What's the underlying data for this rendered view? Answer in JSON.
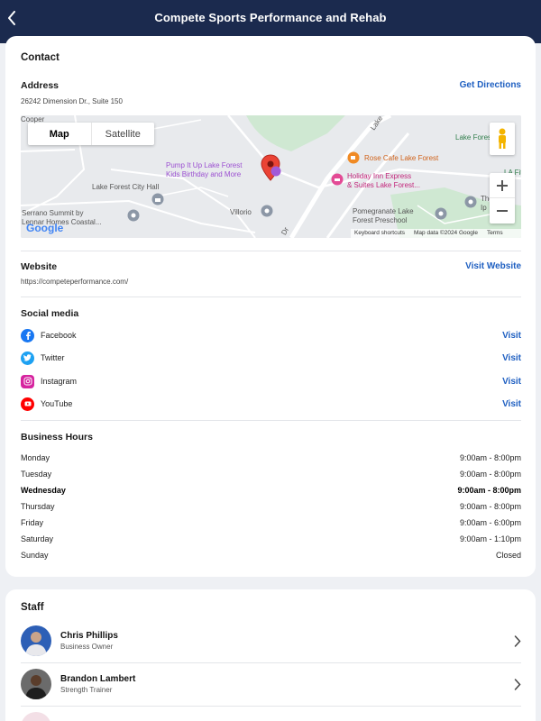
{
  "header": {
    "title": "Compete Sports Performance and Rehab",
    "back_icon": "chevron-left-icon"
  },
  "contact": {
    "title": "Contact",
    "address_label": "Address",
    "address_value": "26242 Dimension Dr., Suite 150",
    "directions_link": "Get Directions",
    "map": {
      "type_map": "Map",
      "type_satellite": "Satellite",
      "places": {
        "pump": "Pump It Up Lake Forest",
        "pump2": "Kids Birthday and More",
        "rose": "Rose Cafe Lake Forest",
        "holiday1": "Holiday Inn Express",
        "holiday2": "& Suites Lake Forest...",
        "cityhall": "Lake Forest City Hall",
        "serrano1": "Serrano Summit by",
        "serrano2": "Lennar Homes Coastal...",
        "villorio": "Villorio",
        "pome1": "Pomegranate Lake",
        "pome2": "Forest Preschool",
        "lakeforest": "Lake Forest",
        "cooper": "Cooper",
        "the": "The",
        "ip": "Ip",
        "lafit": "LA Fitn",
        "lake_road": "Lake",
        "dr_road": "Dr"
      },
      "google": "Google",
      "shortcuts": "Keyboard shortcuts",
      "mapdata": "Map data ©2024 Google",
      "terms": "Terms"
    },
    "website_label": "Website",
    "website_value": "https://competeperformance.com/",
    "website_link": "Visit Website",
    "social_title": "Social media",
    "social": [
      {
        "name": "Facebook",
        "action": "Visit",
        "color": "#1877f2"
      },
      {
        "name": "Twitter",
        "action": "Visit",
        "color": "#1da1f2"
      },
      {
        "name": "Instagram",
        "action": "Visit",
        "color": "#d6249f"
      },
      {
        "name": "YouTube",
        "action": "Visit",
        "color": "#ff0000"
      }
    ],
    "hours_title": "Business Hours",
    "hours": [
      {
        "day": "Monday",
        "time": "9:00am - 8:00pm"
      },
      {
        "day": "Tuesday",
        "time": "9:00am - 8:00pm"
      },
      {
        "day": "Wednesday",
        "time": "9:00am - 8:00pm",
        "today": true
      },
      {
        "day": "Thursday",
        "time": "9:00am - 8:00pm"
      },
      {
        "day": "Friday",
        "time": "9:00am - 6:00pm"
      },
      {
        "day": "Saturday",
        "time": "9:00am - 1:10pm"
      },
      {
        "day": "Sunday",
        "time": "Closed"
      }
    ]
  },
  "staff": {
    "title": "Staff",
    "members": [
      {
        "name": "Chris Phillips",
        "role": "Business Owner"
      },
      {
        "name": "Brandon Lambert",
        "role": "Strength Trainer"
      }
    ]
  }
}
